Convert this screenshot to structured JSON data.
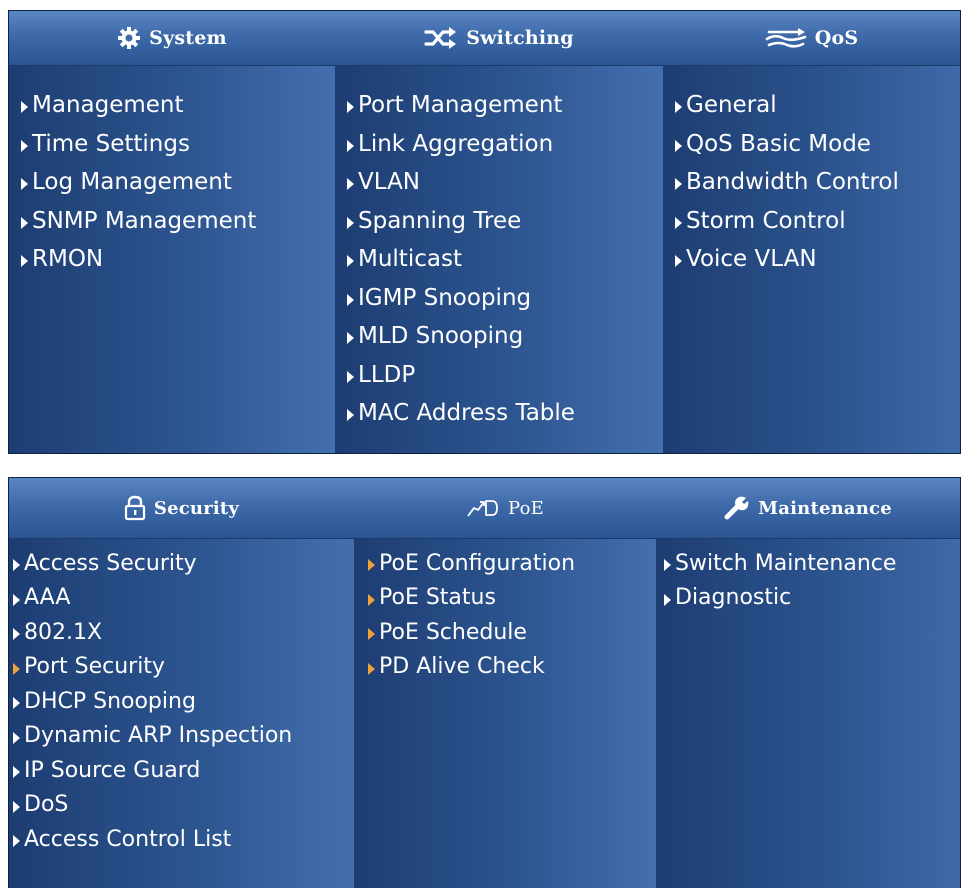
{
  "top_panel": {
    "headers": [
      {
        "label": "System",
        "icon": "gear-icon"
      },
      {
        "label": "Switching",
        "icon": "shuffle-icon"
      },
      {
        "label": "QoS",
        "icon": "qos-waves-icon"
      }
    ],
    "system_items": [
      "Management",
      "Time Settings",
      "Log Management",
      "SNMP Management",
      "RMON"
    ],
    "switching_items": [
      "Port Management",
      "Link Aggregation",
      "VLAN",
      "Spanning Tree",
      "Multicast",
      "IGMP Snooping",
      "MLD Snooping",
      "LLDP",
      "MAC Address Table"
    ],
    "qos_items": [
      "General",
      "QoS Basic Mode",
      "Bandwidth Control",
      "Storm Control",
      "Voice VLAN"
    ]
  },
  "bottom_panel": {
    "headers": [
      {
        "label": "Security",
        "icon": "lock-icon"
      },
      {
        "label": "PoE",
        "icon": "poe-plug-icon"
      },
      {
        "label": "Maintenance",
        "icon": "wrench-icon"
      }
    ],
    "security_items": [
      "Access Security",
      "AAA",
      "802.1X",
      "Port Security",
      "DHCP Snooping",
      "Dynamic ARP Inspection",
      "IP Source Guard",
      "DoS",
      "Access Control List"
    ],
    "poe_items": [
      "PoE Configuration",
      "PoE Status",
      "PoE Schedule",
      "PD Alive Check"
    ],
    "maintenance_items": [
      "Switch Maintenance",
      "Diagnostic"
    ]
  },
  "colors": {
    "header_top": "#5a86c2",
    "header_bottom": "#2b5592",
    "column_dark": "#1d3d72",
    "column_light": "#446fae",
    "highlight_arrow": "#f0a23a"
  }
}
